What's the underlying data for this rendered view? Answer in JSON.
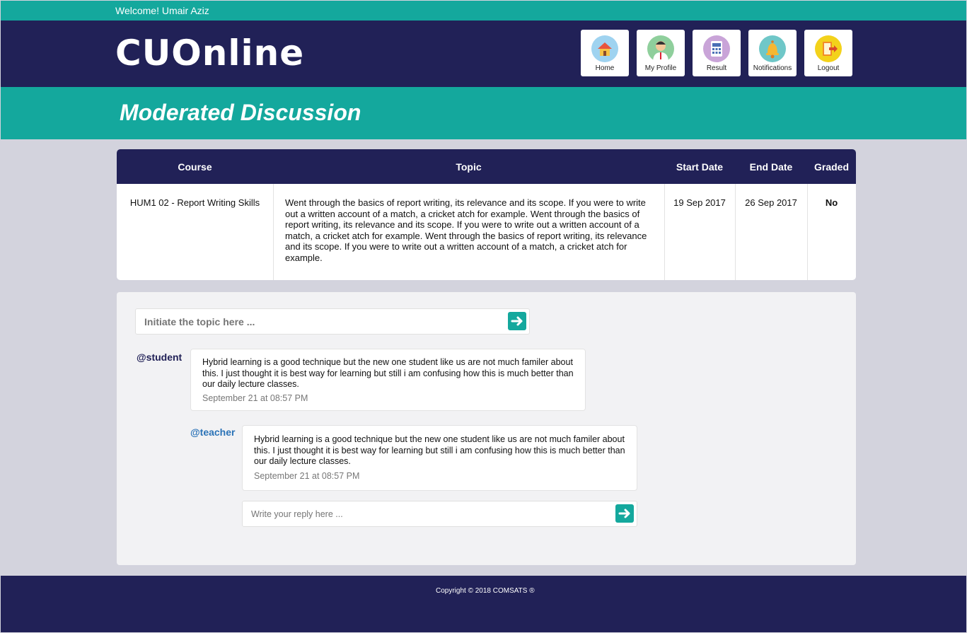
{
  "topbar": {
    "welcome": "Welcome! Umair Aziz"
  },
  "header": {
    "logo": "CUOnline",
    "nav": [
      {
        "label": "Home",
        "icon": "home-icon"
      },
      {
        "label": "My Profile",
        "icon": "profile-icon"
      },
      {
        "label": "Result",
        "icon": "result-icon"
      },
      {
        "label": "Notifications",
        "icon": "bell-icon"
      },
      {
        "label": "Logout",
        "icon": "logout-icon"
      }
    ]
  },
  "banner": {
    "title": "Moderated Discussion"
  },
  "table": {
    "headers": [
      "Course",
      "Topic",
      "Start Date",
      "End Date",
      "Graded"
    ],
    "row": {
      "course": "HUM1 02 - Report Writing Skills",
      "topic": "Went through the basics of report writing, its relevance and its scope. If you were to write out a written account of a match, a cricket atch for example. Went through the basics of report writing, its relevance and its scope. If you were to write out a written account of a match, a cricket atch for example. Went through the basics of report writing, its relevance and its scope. If you were to write out a written account of a match, a cricket atch for example.",
      "start_date": "19 Sep 2017",
      "end_date": "26 Sep 2017",
      "graded": "No"
    }
  },
  "discussion": {
    "topic_placeholder": "Initiate the topic here ...",
    "posts": [
      {
        "user": "@student",
        "text": "Hybrid learning is a good technique but the new one student like us are not much familer about this. I just thought it is best way for learning but still i am confusing how this is much better than our daily lecture classes.",
        "time": "September 21 at 08:57 PM"
      },
      {
        "user": "@teacher",
        "text": "Hybrid learning is a good technique but the new one student like us are not much familer about this. I just thought it is best way for learning but still i am confusing how this is much better than our daily lecture classes.",
        "time": "September 21 at 08:57 PM"
      }
    ],
    "reply_placeholder": "Write your reply here ..."
  },
  "footer": {
    "copyright": "Copyright © 2018 COMSATS ®"
  },
  "colors": {
    "navy": "#212157",
    "teal": "#14a89d",
    "student": "#212157",
    "teacher": "#2b73b7"
  }
}
